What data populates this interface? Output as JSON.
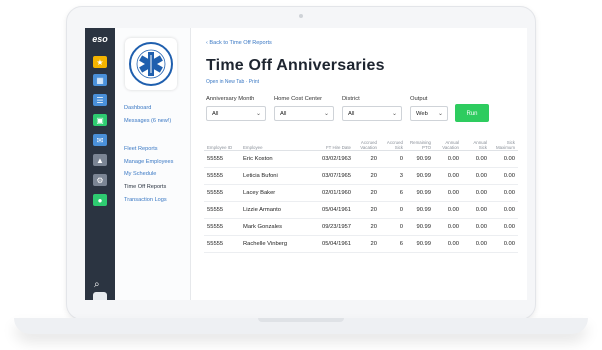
{
  "rail": {
    "brand": "eso",
    "icons": [
      {
        "name": "star-icon",
        "color": "#f5b400"
      },
      {
        "name": "grid-icon",
        "color": "#4a90d9"
      },
      {
        "name": "checklist-icon",
        "color": "#4a90d9"
      },
      {
        "name": "contact-card-icon",
        "color": "#2ecc71"
      },
      {
        "name": "mail-icon",
        "color": "#4a90d9"
      },
      {
        "name": "warning-icon",
        "color": "#7b8594"
      },
      {
        "name": "gear-icon",
        "color": "#7b8594"
      },
      {
        "name": "person-icon",
        "color": "#2ecc71"
      }
    ]
  },
  "logo": {
    "text": "EMERGENCY MEDICAL SERVICES"
  },
  "menu": {
    "group1": [
      "Dashboard",
      "Messages (6 new!)"
    ],
    "group2": [
      "Fleet Reports",
      "Manage Employees",
      "My Schedule",
      "Time Off Reports",
      "Transaction Logs"
    ],
    "active": "Time Off Reports"
  },
  "page": {
    "back_link": "‹ Back to Time Off Reports",
    "title": "Time Off Anniversaries",
    "sublinks": "Open in New Tab · Print"
  },
  "filters": {
    "anniversary_month": {
      "label": "Anniversary Month",
      "value": "All"
    },
    "home_cost_center": {
      "label": "Home Cost Center",
      "value": "All"
    },
    "district": {
      "label": "District",
      "value": "All"
    },
    "output": {
      "label": "Output",
      "value": "Web"
    },
    "run_label": "Run"
  },
  "table": {
    "headers": [
      "Employee ID",
      "Employee",
      "FT Hire Date",
      "Accrued Vacation",
      "Accrued Sick",
      "Remaining PTO",
      "Annual Vacation",
      "Annual Sick",
      "Sick Maximum"
    ],
    "rows": [
      [
        "55555",
        "Eric Koston",
        "03/02/1963",
        "20",
        "0",
        "90.99",
        "0.00",
        "0.00",
        "0.00"
      ],
      [
        "55555",
        "Leticia Bufoni",
        "03/07/1965",
        "20",
        "3",
        "90.99",
        "0.00",
        "0.00",
        "0.00"
      ],
      [
        "55555",
        "Lacey Baker",
        "02/01/1960",
        "20",
        "6",
        "90.99",
        "0.00",
        "0.00",
        "0.00"
      ],
      [
        "55555",
        "Lizzie Armanto",
        "05/04/1961",
        "20",
        "0",
        "90.99",
        "0.00",
        "0.00",
        "0.00"
      ],
      [
        "55555",
        "Mark Gonzales",
        "09/23/1957",
        "20",
        "0",
        "90.99",
        "0.00",
        "0.00",
        "0.00"
      ],
      [
        "55555",
        "Rachelle Vinberg",
        "05/04/1961",
        "20",
        "6",
        "90.99",
        "0.00",
        "0.00",
        "0.00"
      ]
    ]
  },
  "colors": {
    "accent": "#3a78c4",
    "run_button": "#2ecc5f",
    "rail": "#2b3441"
  }
}
